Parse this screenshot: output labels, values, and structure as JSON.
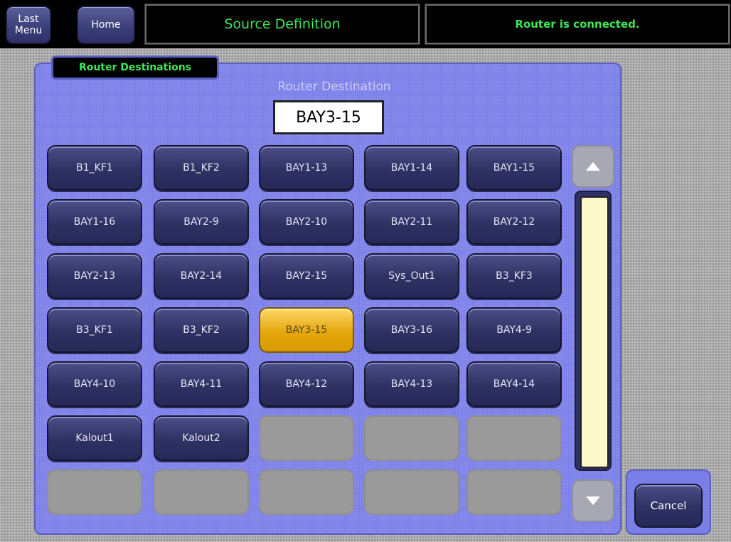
{
  "topbar": {
    "last_menu_label": "Last\nMenu",
    "home_label": "Home",
    "title": "Source Definition",
    "status": "Router is connected."
  },
  "tab": {
    "label": "Router Destinations"
  },
  "destination": {
    "label": "Router Destination",
    "value": "BAY3-15"
  },
  "grid": {
    "rows": [
      [
        "B1_KF1",
        "B1_KF2",
        "BAY1-13",
        "BAY1-14",
        "BAY1-15"
      ],
      [
        "BAY1-16",
        "BAY2-9",
        "BAY2-10",
        "BAY2-11",
        "BAY2-12"
      ],
      [
        "BAY2-13",
        "BAY2-14",
        "BAY2-15",
        "Sys_Out1",
        "B3_KF3"
      ],
      [
        "B3_KF1",
        "B3_KF2",
        "BAY3-15",
        "BAY3-16",
        "BAY4-9"
      ],
      [
        "BAY4-10",
        "BAY4-11",
        "BAY4-12",
        "BAY4-13",
        "BAY4-14"
      ],
      [
        "Kalout1",
        "Kalout2",
        "",
        "",
        ""
      ],
      [
        "",
        "",
        "",
        "",
        ""
      ]
    ],
    "selected": "BAY3-15"
  },
  "scroll": {
    "up_icon": "triangle-up-icon",
    "down_icon": "triangle-down-icon"
  },
  "cancel_label": "Cancel",
  "colors": {
    "status_green": "#3ee65a",
    "panel": "#7a7ee8",
    "selected": "#e3a80d"
  }
}
